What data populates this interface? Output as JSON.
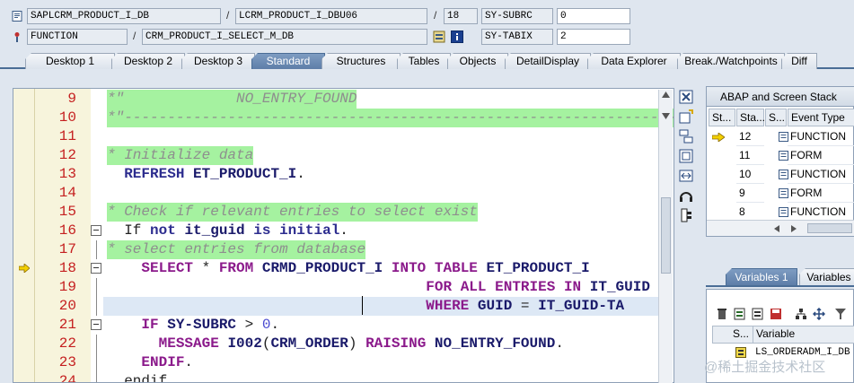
{
  "header": {
    "row1": {
      "program": "SAPLCRM_PRODUCT_I_DB",
      "include": "LCRM_PRODUCT_I_DBU06",
      "line": "18",
      "sysfield_label": "SY-SUBRC",
      "sysfield_value": "0"
    },
    "row2": {
      "type": "FUNCTION",
      "name": "CRM_PRODUCT_I_SELECT_M_DB",
      "sysfield_label": "SY-TABIX",
      "sysfield_value": "2"
    }
  },
  "tabs": [
    {
      "label": "Desktop 1",
      "active": false
    },
    {
      "label": "Desktop 2",
      "active": false
    },
    {
      "label": "Desktop 3",
      "active": false
    },
    {
      "label": "Standard",
      "active": true
    },
    {
      "label": "Structures",
      "active": false
    },
    {
      "label": "Tables",
      "active": false
    },
    {
      "label": "Objects",
      "active": false
    },
    {
      "label": "DetailDisplay",
      "active": false
    },
    {
      "label": "Data Explorer",
      "active": false
    },
    {
      "label": "Break./Watchpoints",
      "active": false
    },
    {
      "label": "Diff",
      "active": false
    }
  ],
  "code": [
    {
      "no": "9",
      "tokens": [
        [
          "c",
          "*\"             NO_ENTRY_FOUND"
        ]
      ],
      "hl": "green",
      "fold": false
    },
    {
      "no": "10",
      "tokens": [
        [
          "c",
          "*\"----------------------------------------------------------------------"
        ]
      ],
      "hl": "green",
      "fold": false
    },
    {
      "no": "11",
      "tokens": [
        [
          "p",
          ""
        ]
      ],
      "hl": "",
      "fold": false
    },
    {
      "no": "12",
      "tokens": [
        [
          "c",
          "* Initialize data"
        ]
      ],
      "hl": "green",
      "fold": false
    },
    {
      "no": "13",
      "tokens": [
        [
          "p",
          "  "
        ],
        [
          "k",
          "REFRESH"
        ],
        [
          "p",
          " "
        ],
        [
          "i",
          "ET_PRODUCT_I"
        ],
        [
          "p",
          "."
        ]
      ],
      "hl": "",
      "fold": false
    },
    {
      "no": "14",
      "tokens": [
        [
          "p",
          ""
        ]
      ],
      "hl": "",
      "fold": false
    },
    {
      "no": "15",
      "tokens": [
        [
          "c",
          "* Check if relevant entries to select exist"
        ]
      ],
      "hl": "green",
      "fold": false
    },
    {
      "no": "16",
      "tokens": [
        [
          "p",
          "  "
        ],
        [
          "p",
          "If"
        ],
        [
          "p",
          " "
        ],
        [
          "k",
          "not"
        ],
        [
          "p",
          " "
        ],
        [
          "i",
          "it_guid"
        ],
        [
          "p",
          " "
        ],
        [
          "k",
          "is"
        ],
        [
          "p",
          " "
        ],
        [
          "k",
          "initial"
        ],
        [
          "p",
          "."
        ]
      ],
      "hl": "",
      "fold": true
    },
    {
      "no": "17",
      "tokens": [
        [
          "c",
          "* select entries from database"
        ]
      ],
      "hl": "green",
      "fold": false
    },
    {
      "no": "18",
      "tokens": [
        [
          "p",
          "    "
        ],
        [
          "k2",
          "SELECT"
        ],
        [
          "p",
          " * "
        ],
        [
          "k2",
          "FROM"
        ],
        [
          "p",
          " "
        ],
        [
          "i",
          "CRMD_PRODUCT_I"
        ],
        [
          "p",
          " "
        ],
        [
          "k2",
          "INTO"
        ],
        [
          "p",
          " "
        ],
        [
          "k2",
          "TABLE"
        ],
        [
          "p",
          " "
        ],
        [
          "i",
          "ET_PRODUCT_I"
        ]
      ],
      "hl": "",
      "fold": true,
      "current": true
    },
    {
      "no": "19",
      "tokens": [
        [
          "p",
          "                                     "
        ],
        [
          "k2",
          "FOR"
        ],
        [
          "p",
          " "
        ],
        [
          "k2",
          "ALL"
        ],
        [
          "p",
          " "
        ],
        [
          "k2",
          "ENTRIES"
        ],
        [
          "p",
          " "
        ],
        [
          "k2",
          "IN"
        ],
        [
          "p",
          " "
        ],
        [
          "i",
          "IT_GUID"
        ]
      ],
      "hl": "",
      "fold": false
    },
    {
      "no": "20",
      "tokens": [
        [
          "p",
          "                                     "
        ],
        [
          "k2",
          "WHERE"
        ],
        [
          "p",
          " "
        ],
        [
          "i",
          "GUID"
        ],
        [
          "p",
          " = "
        ],
        [
          "i",
          "IT_GUID-TA"
        ]
      ],
      "hl": "blue",
      "fold": false
    },
    {
      "no": "21",
      "tokens": [
        [
          "p",
          "    "
        ],
        [
          "k2",
          "IF"
        ],
        [
          "p",
          " "
        ],
        [
          "i",
          "SY-SUBRC"
        ],
        [
          "p",
          " > "
        ],
        [
          "n",
          "0"
        ],
        [
          "p",
          "."
        ]
      ],
      "hl": "",
      "fold": true
    },
    {
      "no": "22",
      "tokens": [
        [
          "p",
          "      "
        ],
        [
          "k2",
          "MESSAGE"
        ],
        [
          "p",
          " "
        ],
        [
          "i",
          "I002"
        ],
        [
          "p",
          "("
        ],
        [
          "i",
          "CRM_ORDER"
        ],
        [
          "p",
          ") "
        ],
        [
          "k2",
          "RAISING"
        ],
        [
          "p",
          " "
        ],
        [
          "i",
          "NO_ENTRY_FOUND"
        ],
        [
          "p",
          "."
        ]
      ],
      "hl": "",
      "fold": false
    },
    {
      "no": "23",
      "tokens": [
        [
          "p",
          "    "
        ],
        [
          "k2",
          "ENDIF"
        ],
        [
          "p",
          "."
        ]
      ],
      "hl": "",
      "fold": false
    },
    {
      "no": "24",
      "tokens": [
        [
          "p",
          "  "
        ],
        [
          "p",
          "endif"
        ]
      ],
      "hl": "",
      "fold": false
    }
  ],
  "stack": {
    "title": "ABAP and Screen Stack",
    "columns": [
      "St...",
      "Sta...",
      "S...",
      "Event Type"
    ],
    "rows": [
      {
        "st": "arrow",
        "level": "12",
        "event": "FUNCTION"
      },
      {
        "st": "",
        "level": "11",
        "event": "FORM"
      },
      {
        "st": "",
        "level": "10",
        "event": "FUNCTION"
      },
      {
        "st": "",
        "level": "9",
        "event": "FORM"
      },
      {
        "st": "",
        "level": "8",
        "event": "FUNCTION"
      }
    ]
  },
  "variables": {
    "tabs": [
      "Variables 1",
      "Variables"
    ],
    "columns": [
      "S...",
      "Variable"
    ],
    "rows": [
      {
        "name": "LS_ORDERADM_I_DB"
      }
    ]
  },
  "watermark": "@稀土掘金技术社区"
}
